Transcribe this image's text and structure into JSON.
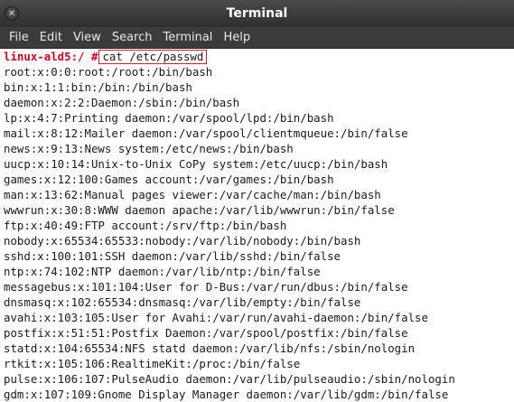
{
  "window": {
    "title": "Terminal"
  },
  "menu": [
    "File",
    "Edit",
    "View",
    "Search",
    "Terminal",
    "Help"
  ],
  "terminal": {
    "prompt": "linux-ald5:/ #",
    "command": "cat /etc/passwd",
    "output": [
      "root:x:0:0:root:/root:/bin/bash",
      "bin:x:1:1:bin:/bin:/bin/bash",
      "daemon:x:2:2:Daemon:/sbin:/bin/bash",
      "lp:x:4:7:Printing daemon:/var/spool/lpd:/bin/bash",
      "mail:x:8:12:Mailer daemon:/var/spool/clientmqueue:/bin/false",
      "news:x:9:13:News system:/etc/news:/bin/bash",
      "uucp:x:10:14:Unix-to-Unix CoPy system:/etc/uucp:/bin/bash",
      "games:x:12:100:Games account:/var/games:/bin/bash",
      "man:x:13:62:Manual pages viewer:/var/cache/man:/bin/bash",
      "wwwrun:x:30:8:WWW daemon apache:/var/lib/wwwrun:/bin/false",
      "ftp:x:40:49:FTP account:/srv/ftp:/bin/bash",
      "nobody:x:65534:65533:nobody:/var/lib/nobody:/bin/bash",
      "sshd:x:100:101:SSH daemon:/var/lib/sshd:/bin/false",
      "ntp:x:74:102:NTP daemon:/var/lib/ntp:/bin/false",
      "messagebus:x:101:104:User for D-Bus:/var/run/dbus:/bin/false",
      "dnsmasq:x:102:65534:dnsmasq:/var/lib/empty:/bin/false",
      "avahi:x:103:105:User for Avahi:/var/run/avahi-daemon:/bin/false",
      "postfix:x:51:51:Postfix Daemon:/var/spool/postfix:/bin/false",
      "statd:x:104:65534:NFS statd daemon:/var/lib/nfs:/sbin/nologin",
      "rtkit:x:105:106:RealtimeKit:/proc:/bin/false",
      "pulse:x:106:107:PulseAudio daemon:/var/lib/pulseaudio:/sbin/nologin",
      "gdm:x:107:109:Gnome Display Manager daemon:/var/lib/gdm:/bin/false"
    ]
  }
}
